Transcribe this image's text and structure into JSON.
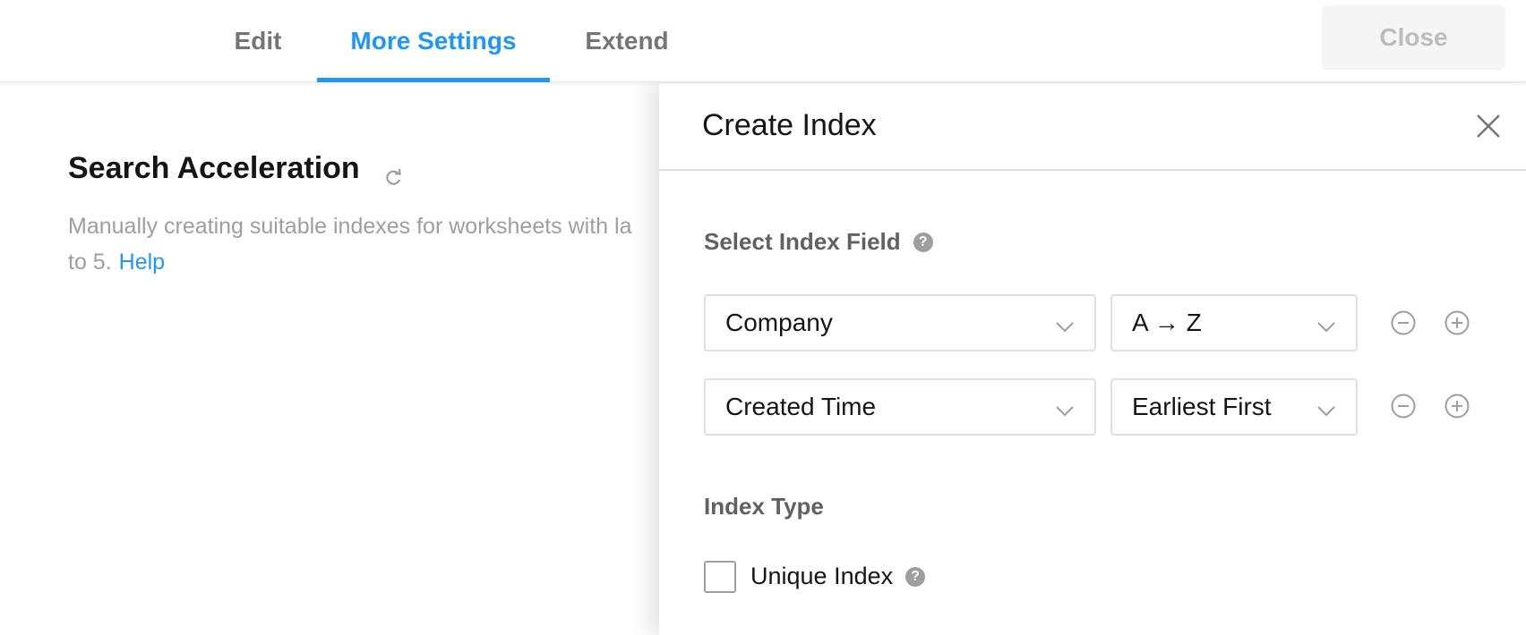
{
  "tabs": {
    "edit": "Edit",
    "more_settings": "More Settings",
    "extend": "Extend",
    "close": "Close"
  },
  "page": {
    "title": "Search Acceleration",
    "description_line1": "Manually creating suitable indexes for worksheets with la",
    "description_line2": "to 5.",
    "help_link": "Help"
  },
  "drawer": {
    "title": "Create Index",
    "select_field_label": "Select Index Field",
    "rows": [
      {
        "field": "Company",
        "order": "A → Z"
      },
      {
        "field": "Created Time",
        "order": "Earliest First"
      }
    ],
    "index_type_label": "Index Type",
    "unique_index_label": "Unique Index"
  },
  "colors": {
    "accent": "#2196f3",
    "muted_text": "#9e9e9e",
    "tab_text": "#757575"
  }
}
